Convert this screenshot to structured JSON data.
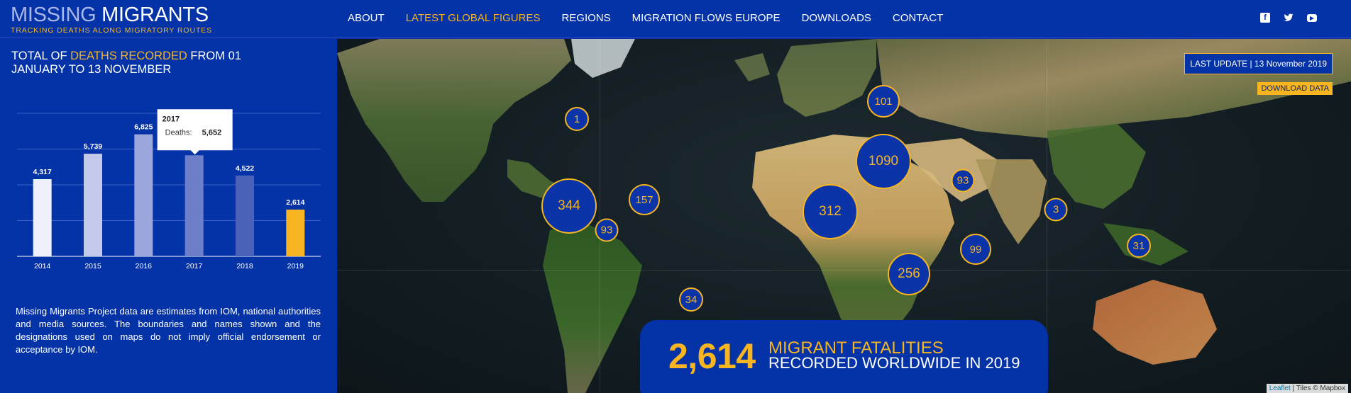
{
  "header": {
    "logo_thin": "MISSING",
    "logo_bold": "MIGRANTS",
    "tagline": "TRACKING DEATHS ALONG MIGRATORY ROUTES",
    "nav": [
      "ABOUT",
      "LATEST GLOBAL FIGURES",
      "REGIONS",
      "MIGRATION FLOWS EUROPE",
      "DOWNLOADS",
      "CONTACT"
    ],
    "active_nav": "LATEST GLOBAL FIGURES",
    "social_icons": [
      "facebook-icon",
      "twitter-icon",
      "youtube-icon"
    ]
  },
  "left_panel": {
    "title_pre": "TOTAL OF ",
    "title_highlight": "DEATHS RECORDED",
    "title_post": " FROM 01 JANUARY TO 13 NOVEMBER",
    "note": "Missing Migrants Project data are estimates from IOM, national authorities and media sources. The boundaries and names shown and the designations used on maps do not imply official endorsement or acceptance by IOM."
  },
  "chart_data": {
    "type": "bar",
    "categories": [
      "2014",
      "2015",
      "2016",
      "2017",
      "2018",
      "2019"
    ],
    "values": [
      4317,
      5739,
      6825,
      5652,
      4522,
      2614
    ],
    "value_labels": [
      "4,317",
      "5,739",
      "6,825",
      "",
      "4,522",
      "2,614"
    ],
    "colors": [
      "#eef0fa",
      "#c3c9ea",
      "#9aa6dc",
      "#6d7fc8",
      "#4a62b8",
      "#f6b521"
    ],
    "ylim": [
      0,
      8000
    ],
    "grid": true,
    "tooltip": {
      "title": "2017",
      "label": "Deaths:",
      "value": "5,652"
    }
  },
  "map": {
    "last_update_label": "LAST UPDATE",
    "last_update_value": "13 November 2019",
    "download_label": "DOWNLOAD DATA",
    "attribution_link": "Leaflet",
    "attribution_rest": " | Tiles © Mapbox",
    "clusters": [
      {
        "label": "1"
      },
      {
        "label": "101"
      },
      {
        "label": "1090"
      },
      {
        "label": "93"
      },
      {
        "label": "344"
      },
      {
        "label": "157"
      },
      {
        "label": "93"
      },
      {
        "label": "312"
      },
      {
        "label": "3"
      },
      {
        "label": "99"
      },
      {
        "label": "31"
      },
      {
        "label": "256"
      },
      {
        "label": "34"
      }
    ]
  },
  "summary": {
    "number": "2,614",
    "line1": "MIGRANT FATALITIES",
    "line2": "RECORDED WORLDWIDE IN 2019"
  }
}
